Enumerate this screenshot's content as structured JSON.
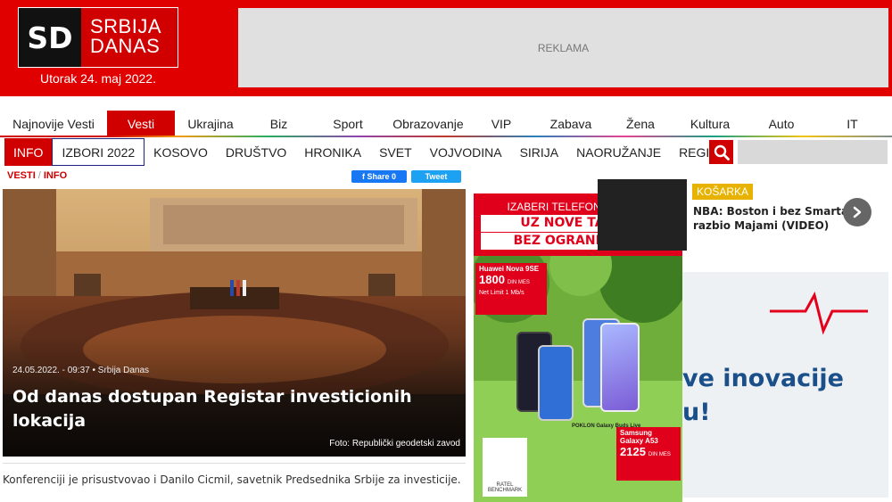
{
  "header": {
    "logo_mark": "SD",
    "logo_line1": "SRBIJA",
    "logo_line2": "DANAS",
    "date": "Utorak 24. maj 2022.",
    "ad_label": "REKLAMA",
    "brand_color": "#d00000"
  },
  "main_nav": [
    {
      "label": "Najnovije Vesti",
      "width": 120
    },
    {
      "label": "Vesti",
      "width": 76,
      "active": true
    },
    {
      "label": "Ukrajina",
      "width": 80
    },
    {
      "label": "Biz",
      "width": 73
    },
    {
      "label": "Sport",
      "width": 82
    },
    {
      "label": "Obrazovanje",
      "width": 98
    },
    {
      "label": "VIP",
      "width": 66
    },
    {
      "label": "Zabava",
      "width": 90
    },
    {
      "label": "Žena",
      "width": 66
    },
    {
      "label": "Kultura",
      "width": 90
    },
    {
      "label": "Auto",
      "width": 70
    },
    {
      "label": "IT",
      "width": 89
    }
  ],
  "sub_nav": [
    {
      "label": "INFO",
      "active": true
    },
    {
      "label": "IZBORI 2022",
      "boxed": true
    },
    {
      "label": "KOSOVO"
    },
    {
      "label": "DRUŠTVO"
    },
    {
      "label": "HRONIKA"
    },
    {
      "label": "SVET"
    },
    {
      "label": "VOJVODINA"
    },
    {
      "label": "SIRIJA"
    },
    {
      "label": "NAORUŽANJE"
    },
    {
      "label": "REGION"
    }
  ],
  "search": {
    "icon": "search-icon"
  },
  "breadcrumb": {
    "first": "VESTI",
    "sep": "/",
    "second": "INFO"
  },
  "share": {
    "facebook": "f  Share 0",
    "twitter": "Tweet"
  },
  "article": {
    "meta": "24.05.2022. - 09:37  •  Srbija Danas",
    "title": "Od danas dostupan Registar investicionih lokacija",
    "credit": "Foto: Republički geodetski zavod",
    "lead": "Konferenciji je prisustvovao i Danilo Cicmil, savetnik Predsednika Srbije za investicije."
  },
  "mid_ad": {
    "line1": "IZABERI TELEFON NA RATE",
    "line2": "UZ NOVE TARIFE",
    "line3": "BEZ OGRANIČENJA",
    "phone1_name": "Huawei Nova 9SE",
    "phone1_price": "1800",
    "phone1_unit": "DIN MES",
    "net_label": "Net Limit 1 Mb/s",
    "phone2_name": "Samsung Galaxy A53",
    "phone2_price": "2125",
    "phone2_unit": "DIN MES",
    "badge": "POKLON Galaxy Buds Live",
    "ratel": "RATEL BENCHMARK"
  },
  "side_card": {
    "tag": "KOŠARKA",
    "title": "NBA: Boston i bez Smarta razbio Majami (VIDEO)"
  },
  "right_ad": {
    "line1": "ve inovacije",
    "line2": "u!"
  }
}
